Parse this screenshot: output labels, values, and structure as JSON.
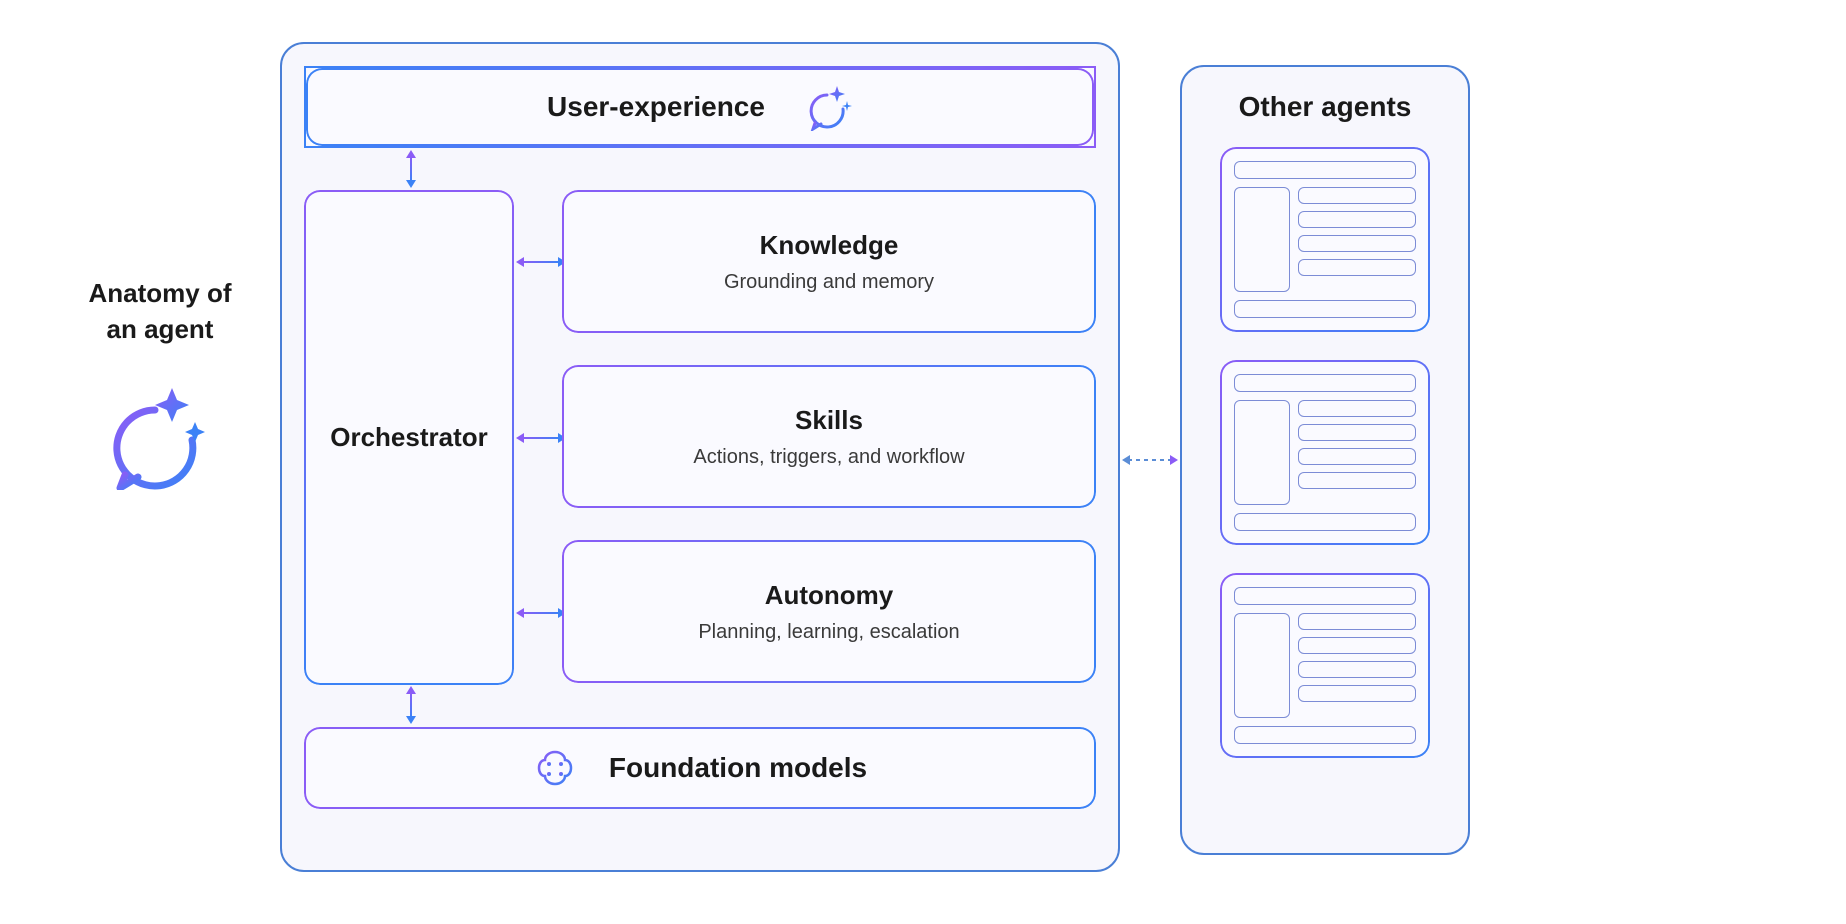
{
  "title": {
    "line1": "Anatomy of",
    "line2": "an agent"
  },
  "main": {
    "userExperience": "User-experience",
    "orchestrator": "Orchestrator",
    "knowledge": {
      "title": "Knowledge",
      "subtitle": "Grounding and memory"
    },
    "skills": {
      "title": "Skills",
      "subtitle": "Actions, triggers, and workflow"
    },
    "autonomy": {
      "title": "Autonomy",
      "subtitle": "Planning, learning, escalation"
    },
    "foundation": "Foundation models"
  },
  "otherAgents": {
    "title": "Other agents"
  },
  "colors": {
    "gradientStart": "#8b5cf6",
    "gradientEnd": "#3b82f6",
    "borderBlue": "#4a7fd6",
    "boxBg": "#fafaff",
    "containerBg": "#f7f7fd"
  }
}
